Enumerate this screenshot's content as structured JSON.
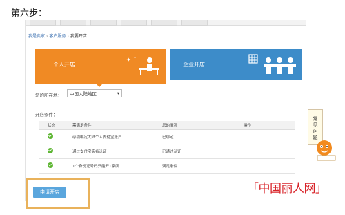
{
  "caption": "第六步：",
  "breadcrumb": {
    "items": [
      "我是卖家",
      "客户服务"
    ],
    "current": "我要开店"
  },
  "tabs": [
    {
      "label": "个人开店"
    },
    {
      "label": "企业开店"
    }
  ],
  "location": {
    "label": "您的所在地：",
    "value": "中国大陆地区"
  },
  "conditions": {
    "label": "开店条件：",
    "headers": [
      "状态",
      "需满足条件",
      "您的情况",
      "操作"
    ],
    "rows": [
      {
        "condition": "必须绑定大陆个人支付宝账户",
        "status": "已绑定",
        "action": ""
      },
      {
        "condition": "通过支付宝实名认证",
        "status": "已通过认证",
        "action": ""
      },
      {
        "condition": "1个身份证号码只能开1家店",
        "status": "满足条件",
        "action": ""
      }
    ]
  },
  "apply_button": "申请开店",
  "help": "常见问题",
  "watermark": "「中国丽人网」",
  "colors": {
    "personal_tab": "#f08a24",
    "company_tab": "#3d8cc9",
    "check": "#5cb531",
    "apply": "#5aa6dd",
    "watermark": "#d8242a"
  }
}
